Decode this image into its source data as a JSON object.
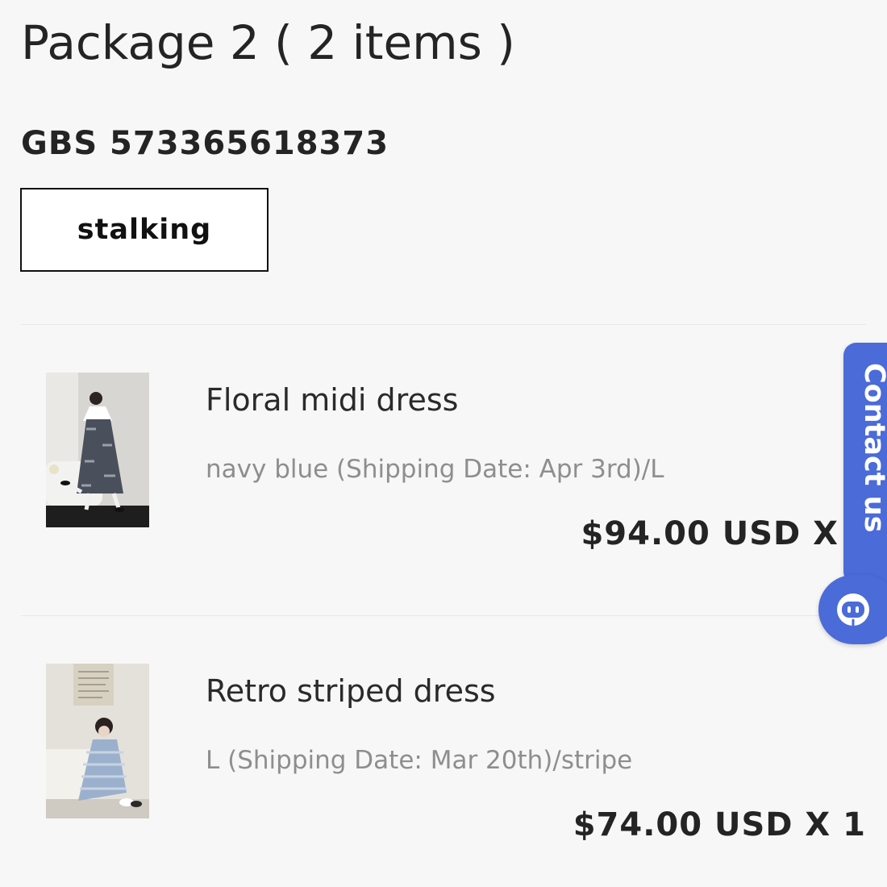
{
  "package": {
    "title": "Package 2 ( 2 items )",
    "tracking_number": "GBS 573365618373",
    "track_button_label": "stalking"
  },
  "items": [
    {
      "name": "Floral midi dress",
      "variant": "navy blue (Shipping Date: Apr 3rd)/L",
      "price": "$94.00 USD X",
      "thumbnail_icon": "floral-dress-photo"
    },
    {
      "name": "Retro striped dress",
      "variant": "L (Shipping Date: Mar 20th)/stripe",
      "price": "$74.00 USD X 1",
      "thumbnail_icon": "striped-dress-photo"
    }
  ],
  "contact_widget": {
    "label": "Contact us",
    "icon": "chat-bot-icon"
  },
  "colors": {
    "background": "#f7f7f7",
    "text_primary": "#242424",
    "text_secondary": "#8e8e8e",
    "accent": "#4a6bd8",
    "button_border": "#111111"
  }
}
